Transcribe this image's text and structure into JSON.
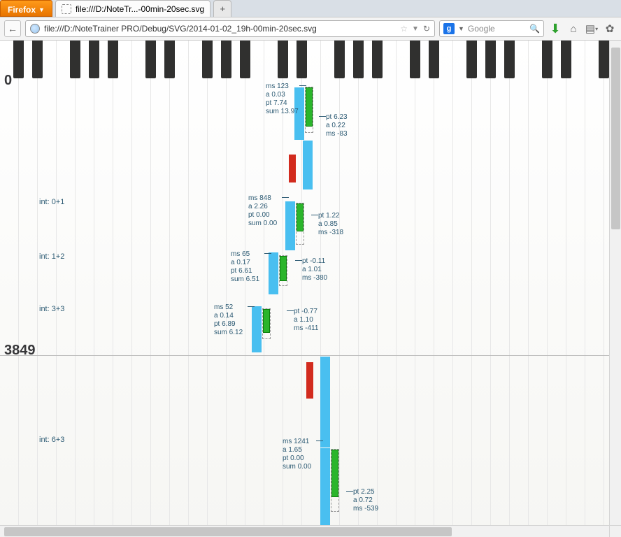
{
  "chrome": {
    "firefox_label": "Firefox",
    "tab_title": "file:///D:/NoteTr...-00min-20sec.svg",
    "newtab": "+",
    "back": "←",
    "url": "file:///D:/NoteTrainer PRO/Debug/SVG/2014-01-02_19h-00min-20sec.svg",
    "search_engine_letter": "g",
    "search_placeholder": "Google"
  },
  "labels": {
    "top": "0",
    "mid": "3849"
  },
  "ints": {
    "a": "int: 0+1",
    "b": "int: 1+2",
    "c": "int: 3+3",
    "d": "int: 6+3"
  },
  "notes": {
    "n1": {
      "left": {
        "l1": "ms 123",
        "l2": "a 0.03",
        "l3": "pt 7.74",
        "l4": "sum 13.97"
      },
      "right": {
        "l1": "pt 6.23",
        "l2": "a 0.22",
        "l3": "ms -83"
      }
    },
    "n2": {
      "left": {
        "l1": "ms 848",
        "l2": "a 2.26",
        "l3": "pt 0.00",
        "l4": "sum 0.00"
      },
      "right": {
        "l1": "pt 1.22",
        "l2": "a 0.85",
        "l3": "ms -318"
      }
    },
    "n3": {
      "left": {
        "l1": "ms 65",
        "l2": "a 0.17",
        "l3": "pt 6.61",
        "l4": "sum 6.51"
      },
      "right": {
        "l1": "pt -0.11",
        "l2": "a 1.01",
        "l3": "ms -380"
      }
    },
    "n4": {
      "left": {
        "l1": "ms 52",
        "l2": "a 0.14",
        "l3": "pt 6.89",
        "l4": "sum 6.12"
      },
      "right": {
        "l1": "pt -0.77",
        "l2": "a 1.10",
        "l3": "ms -411"
      }
    },
    "n5": {
      "left": {
        "l1": "ms 1241",
        "l2": "a 1.65",
        "l3": "pt 0.00",
        "l4": "sum 0.00"
      },
      "right": {
        "l1": "pt 2.25",
        "l2": "a 0.72",
        "l3": "ms -539"
      }
    }
  },
  "chart_data": {
    "type": "table",
    "title": "NoteTrainer PRO SVG timeline 2014-01-02 19h-00min-20sec",
    "y_markers": [
      0,
      3849
    ],
    "intervals": [
      "0+1",
      "1+2",
      "3+3",
      "6+3"
    ],
    "events": [
      {
        "ms": 123,
        "a": 0.03,
        "pt": 7.74,
        "sum": 13.97,
        "resp_pt": 6.23,
        "resp_a": 0.22,
        "resp_ms": -83
      },
      {
        "ms": 848,
        "a": 2.26,
        "pt": 0.0,
        "sum": 0.0,
        "resp_pt": 1.22,
        "resp_a": 0.85,
        "resp_ms": -318
      },
      {
        "ms": 65,
        "a": 0.17,
        "pt": 6.61,
        "sum": 6.51,
        "resp_pt": -0.11,
        "resp_a": 1.01,
        "resp_ms": -380
      },
      {
        "ms": 52,
        "a": 0.14,
        "pt": 6.89,
        "sum": 6.12,
        "resp_pt": -0.77,
        "resp_a": 1.1,
        "resp_ms": -411
      },
      {
        "ms": 1241,
        "a": 1.65,
        "pt": 0.0,
        "sum": 0.0,
        "resp_pt": 2.25,
        "resp_a": 0.72,
        "resp_ms": -539
      }
    ]
  }
}
